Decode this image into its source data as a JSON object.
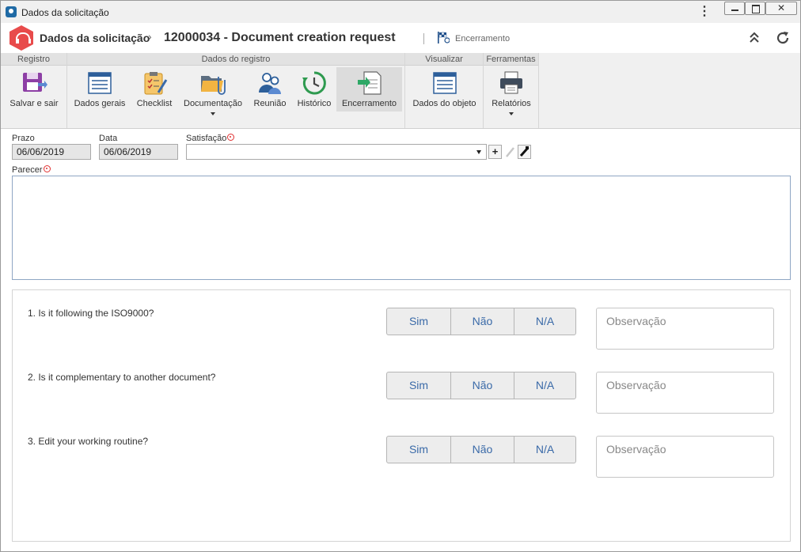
{
  "window": {
    "title": "Dados da solicitação",
    "close_label": "✕"
  },
  "header": {
    "breadcrumb_parent": "Dados da solicitação",
    "breadcrumb_separator": "›",
    "record_title": "12000034 - Document creation request",
    "status": "Encerramento"
  },
  "ribbon": {
    "groups": {
      "registro": "Registro",
      "dados_registro": "Dados do registro",
      "visualizar": "Visualizar",
      "ferramentas": "Ferramentas"
    },
    "buttons": {
      "salvar": "Salvar e sair",
      "dados_gerais": "Dados gerais",
      "checklist": "Checklist",
      "documentacao": "Documentação",
      "reuniao": "Reunião",
      "historico": "Histórico",
      "encerramento": "Encerramento",
      "dados_objeto": "Dados do objeto",
      "relatorios": "Relatórios"
    },
    "active": "Encerramento"
  },
  "form": {
    "prazo_label": "Prazo",
    "prazo_value": "06/06/2019",
    "data_label": "Data",
    "data_value": "06/06/2019",
    "satisfacao_label": "Satisfação",
    "satisfacao_value": "",
    "add_label": "+",
    "parecer_label": "Parecer",
    "parecer_value": ""
  },
  "questions": [
    {
      "text": "1. Is it following the ISO9000?",
      "options": [
        "Sim",
        "Não",
        "N/A"
      ],
      "observation_placeholder": "Observação"
    },
    {
      "text": "2. Is it complementary to another document?",
      "options": [
        "Sim",
        "Não",
        "N/A"
      ],
      "observation_placeholder": "Observação"
    },
    {
      "text": "3. Edit your working routine?",
      "options": [
        "Sim",
        "Não",
        "N/A"
      ],
      "observation_placeholder": "Observação"
    }
  ],
  "colors": {
    "brand_hex": "#e84b4b",
    "option_text": "#3a6aa8",
    "required": "#e03030"
  }
}
